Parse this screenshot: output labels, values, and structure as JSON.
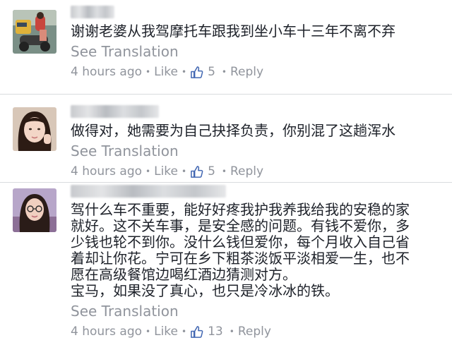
{
  "comments": [
    {
      "text": "谢谢老婆从我驾摩托车跟我到坐小车十三年不离不弃",
      "see_translation": "See Translation",
      "time": "4 hours ago",
      "like": "Like",
      "likes": "5",
      "reply": "Reply"
    },
    {
      "text": "做得对，她需要为自己抉择负责，你别混了这趟浑水",
      "see_translation": "See Translation",
      "time": "4 hours ago",
      "like": "Like",
      "likes": "5",
      "reply": "Reply"
    },
    {
      "text": "驾什么车不重要，能好好疼我护我养我给我的安稳的家\n就好。这不关车事，是安全感的问题。有钱不爱你，多\n少钱也轮不到你。没什么钱但爱你，每个月收入自己省\n着却让你花。宁可在乡下粗茶淡饭平淡相爱一生，也不\n愿在高级餐馆边喝红酒边猜测对方。\n宝马，如果没了真心，也只是冷冰冰的铁。",
      "see_translation": "See Translation",
      "time": "4 hours ago",
      "like": "Like",
      "likes": "13",
      "reply": "Reply"
    }
  ],
  "colors": {
    "text": "#1d2129",
    "meta": "#90949c",
    "like_icon": "#4267b2",
    "divider": "#d9dbde"
  },
  "icons": {
    "like": "thumbs-up-icon",
    "separator": "dot"
  }
}
